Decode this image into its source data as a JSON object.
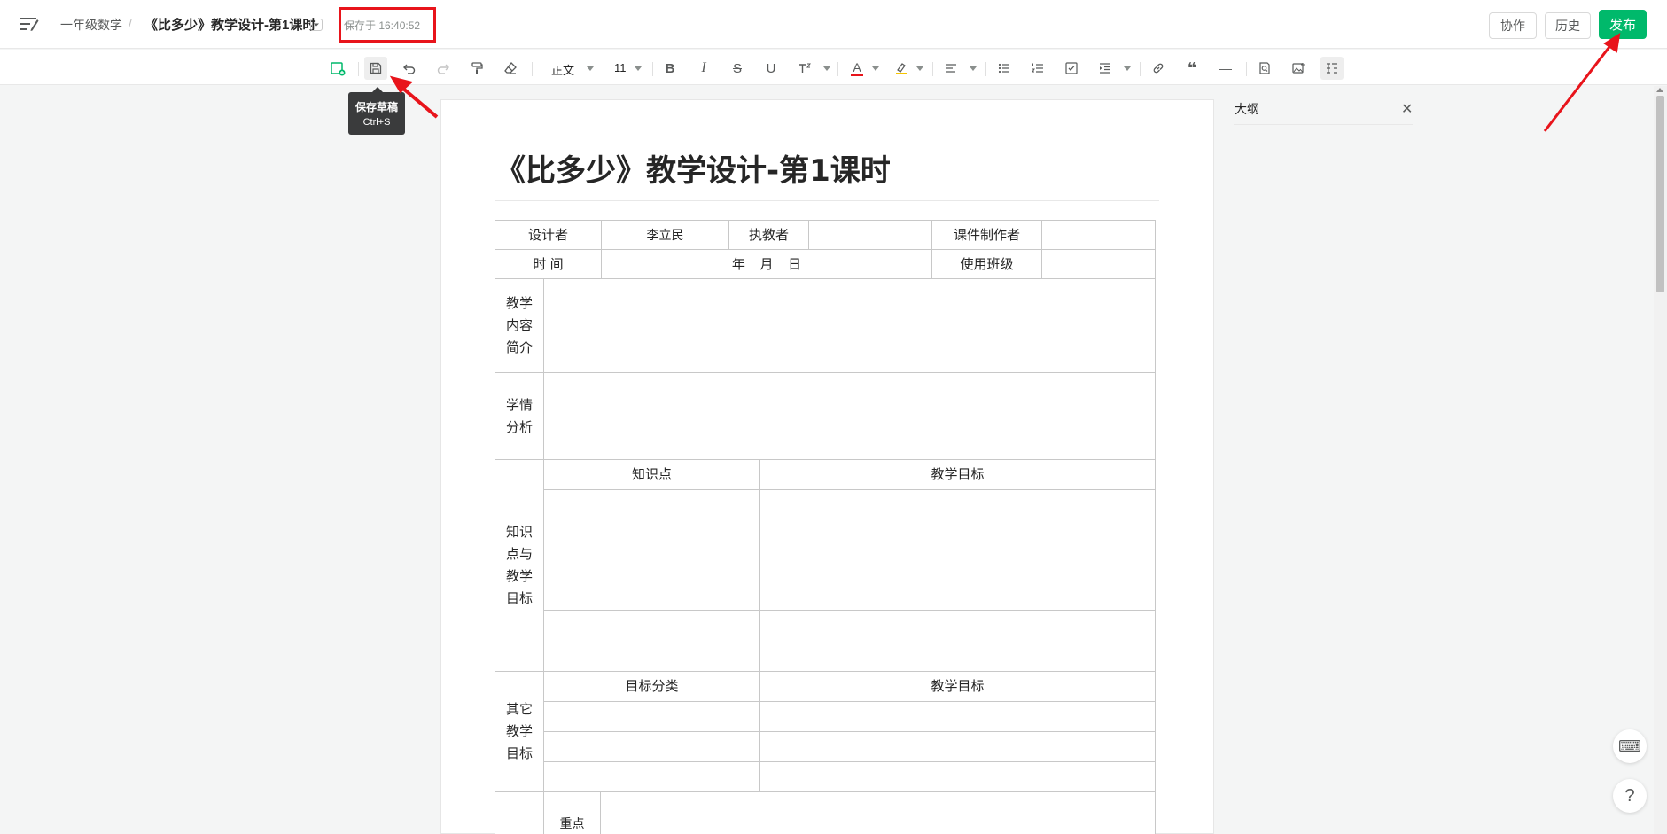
{
  "header": {
    "breadcrumb": "一年级数学",
    "separator": "/",
    "doc_title": "《比多少》教学设计-第1课时",
    "save_status": "保存于 16:40:52",
    "collab_label": "协作",
    "history_label": "历史",
    "publish_label": "发布"
  },
  "toolbar": {
    "style_value": "正文",
    "font_size_value": "11",
    "tooltip_title": "保存草稿",
    "tooltip_shortcut": "Ctrl+S",
    "icons": [
      "add-doc-icon",
      "save-draft-icon",
      "undo-icon",
      "redo-icon",
      "format-painter-icon",
      "clear-format-icon",
      "bold-icon",
      "italic-icon",
      "strikethrough-icon",
      "underline-icon",
      "superscript-icon",
      "font-color-icon",
      "highlight-icon",
      "align-icon",
      "bullet-list-icon",
      "ordered-list-icon",
      "task-list-icon",
      "indent-icon",
      "link-icon",
      "quote-icon",
      "divider-icon",
      "search-replace-icon",
      "image-icon",
      "outline-toggle-icon"
    ],
    "bold_glyph": "B",
    "italic_glyph": "I",
    "strike_glyph": "S",
    "underline_glyph": "U",
    "font_color_glyph": "A",
    "quote_glyph": "❝",
    "divider_glyph": "—"
  },
  "document": {
    "title": "《比多少》教学设计-第1课时",
    "table": {
      "designer_label": "设计者",
      "designer_value": "李立民",
      "teacher_label": "执教者",
      "courseware_label": "课件制作者",
      "time_label": "时 间",
      "date_placeholder": "年    月    日",
      "class_label": "使用班级",
      "content_label": "教学内容简介",
      "analysis_label": "学情分析",
      "knowledge_section_label": "知识点与教学目标",
      "knowledge_col": "知识点",
      "goal_col": "教学目标",
      "other_section_label": "其它教学目标",
      "category_col": "目标分类",
      "goal_col_2": "教学目标",
      "key_point_label": "重点"
    }
  },
  "outline": {
    "title": "大纲",
    "close_glyph": "✕"
  },
  "float": {
    "keyboard_glyph": "⌨",
    "help_glyph": "?"
  },
  "colors": {
    "publish_bg": "#00b96b",
    "annotation_red": "#e8141b",
    "font_color_red": "#e8141b",
    "highlight_yellow": "#f5c400"
  }
}
